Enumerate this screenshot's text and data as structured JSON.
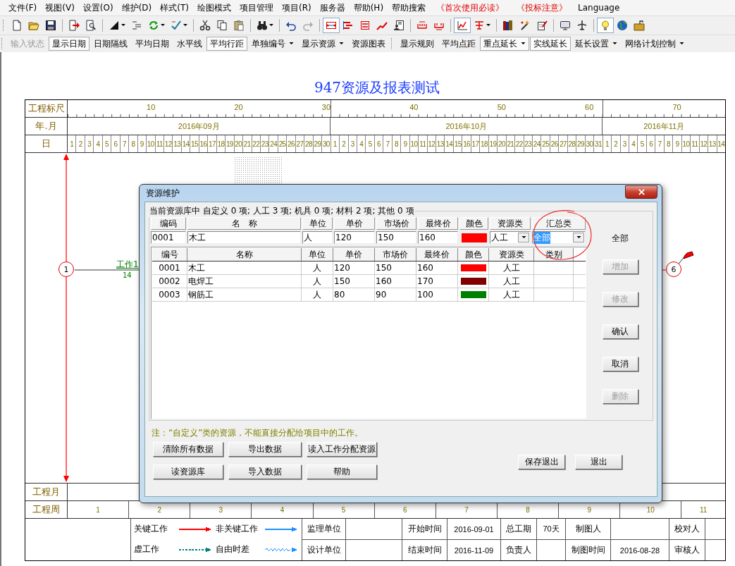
{
  "menu": [
    {
      "label": "文件(F)",
      "kind": "normal"
    },
    {
      "label": "视图(V)",
      "kind": "normal"
    },
    {
      "label": "设置(O)",
      "kind": "normal"
    },
    {
      "label": "维护(D)",
      "kind": "normal"
    },
    {
      "label": "样式(T)",
      "kind": "normal"
    },
    {
      "label": "绘图模式",
      "kind": "normal"
    },
    {
      "label": "项目管理",
      "kind": "normal"
    },
    {
      "label": "项目(R)",
      "kind": "normal"
    },
    {
      "label": "服务器",
      "kind": "normal"
    },
    {
      "label": "帮助(H)",
      "kind": "normal"
    },
    {
      "label": "帮助搜索",
      "kind": "normal"
    },
    {
      "label": "《首次使用必读》",
      "kind": "notice"
    },
    {
      "label": "《投标注意》",
      "kind": "notice"
    },
    {
      "label": "Language",
      "kind": "normal"
    }
  ],
  "toolbar_buttons": [
    {
      "pressed": false,
      "dropdown": false
    },
    {
      "pressed": false,
      "dropdown": false
    },
    {
      "pressed": false,
      "dropdown": false
    },
    {
      "pressed": false,
      "dropdown": false
    },
    {
      "pressed": false,
      "dropdown": false
    },
    {
      "pressed": false,
      "dropdown": true
    },
    {
      "pressed": false,
      "dropdown": false
    },
    {
      "pressed": false,
      "dropdown": true
    },
    {
      "pressed": false,
      "dropdown": true
    },
    {
      "pressed": false,
      "dropdown": false
    },
    {
      "pressed": false,
      "dropdown": false
    },
    {
      "pressed": false,
      "dropdown": false
    },
    {
      "pressed": false,
      "dropdown": true
    },
    {
      "pressed": false,
      "dropdown": false
    },
    {
      "pressed": false,
      "dropdown": false
    },
    {
      "pressed": true,
      "dropdown": false
    },
    {
      "pressed": false,
      "dropdown": false
    },
    {
      "pressed": false,
      "dropdown": false
    },
    {
      "pressed": false,
      "dropdown": false
    },
    {
      "pressed": false,
      "dropdown": false
    },
    {
      "pressed": false,
      "dropdown": false
    },
    {
      "pressed": false,
      "dropdown": false
    },
    {
      "pressed": true,
      "dropdown": false
    },
    {
      "pressed": false,
      "dropdown": true
    },
    {
      "pressed": false,
      "dropdown": false
    },
    {
      "pressed": false,
      "dropdown": false
    },
    {
      "pressed": false,
      "dropdown": false
    },
    {
      "pressed": false,
      "dropdown": false
    },
    {
      "pressed": false,
      "dropdown": false
    },
    {
      "pressed": true,
      "dropdown": false
    },
    {
      "pressed": false,
      "dropdown": false
    },
    {
      "pressed": false,
      "dropdown": false
    }
  ],
  "toolbar2": [
    [
      {
        "label": "输入状态",
        "disabled": true,
        "pressed": false,
        "dropdown": false
      },
      {
        "label": "显示日期",
        "disabled": false,
        "pressed": true,
        "dropdown": false
      },
      {
        "label": "日期隔线",
        "disabled": false,
        "pressed": false,
        "dropdown": false
      },
      {
        "label": "平均日期",
        "disabled": false,
        "pressed": false,
        "dropdown": false
      },
      {
        "label": "水平线",
        "disabled": false,
        "pressed": false,
        "dropdown": false
      },
      {
        "label": "平均行距",
        "disabled": false,
        "pressed": true,
        "dropdown": false
      },
      {
        "label": "单独编号",
        "disabled": false,
        "pressed": false,
        "dropdown": true
      },
      {
        "label": "显示资源",
        "disabled": false,
        "pressed": false,
        "dropdown": true
      },
      {
        "label": "资源图表",
        "disabled": false,
        "pressed": false,
        "dropdown": false
      }
    ],
    [
      {
        "label": "显示规则",
        "disabled": false,
        "pressed": false,
        "dropdown": false
      },
      {
        "label": "平均点距",
        "disabled": false,
        "pressed": false,
        "dropdown": false
      },
      {
        "label": "重点延长",
        "disabled": false,
        "pressed": true,
        "dropdown": true
      },
      {
        "label": "实线延长",
        "disabled": false,
        "pressed": true,
        "dropdown": false
      },
      {
        "label": "延长设置",
        "disabled": false,
        "pressed": false,
        "dropdown": true
      },
      {
        "label": "网络计划控制",
        "disabled": false,
        "pressed": false,
        "dropdown": true
      }
    ]
  ],
  "chart_title": "947资源及报表测试",
  "ruler": {
    "label": "工程标尺",
    "ticks": [
      "10",
      "20",
      "30",
      "40",
      "50",
      "60",
      "70"
    ]
  },
  "month_row": {
    "label": "年.月",
    "months": [
      {
        "label": "2016年09月",
        "days": [
          "1",
          "2",
          "3",
          "4",
          "5",
          "6",
          "7",
          "8",
          "9",
          "10",
          "11",
          "12",
          "13",
          "14",
          "15",
          "16",
          "17",
          "18",
          "19",
          "20",
          "21",
          "22",
          "23",
          "24",
          "25",
          "26",
          "27",
          "28",
          "29",
          "30"
        ]
      },
      {
        "label": "2016年10月",
        "days": [
          "1",
          "2",
          "3",
          "4",
          "5",
          "6",
          "7",
          "8",
          "9",
          "10",
          "11",
          "12",
          "13",
          "14",
          "15",
          "16",
          "17",
          "18",
          "19",
          "20",
          "21",
          "22",
          "23",
          "24",
          "25",
          "26",
          "27",
          "28",
          "29",
          "30",
          "31"
        ]
      },
      {
        "label": "2016年11月",
        "days": [
          "1",
          "2",
          "3",
          "4",
          "5",
          "6",
          "7",
          "8",
          "9",
          "10",
          "11",
          "12",
          "13",
          "14"
        ]
      }
    ]
  },
  "day_label": "日",
  "diagram": {
    "nodes": [
      {
        "label": "1"
      },
      {
        "label": "6"
      }
    ],
    "work": {
      "name": "工作1",
      "duration": "14"
    }
  },
  "project_month_label": "工程月",
  "project_week": {
    "label": "工程周",
    "weeks": [
      "1",
      "2",
      "3",
      "4",
      "5",
      "6",
      "7",
      "8",
      "9",
      "10",
      "11"
    ]
  },
  "legend": [
    {
      "label": "关键工作",
      "kind": "solid",
      "color": "#ff0000"
    },
    {
      "label": "非关键工作",
      "kind": "solid",
      "color": "#1e90ff"
    },
    {
      "label": "虚工作",
      "kind": "dashed",
      "color": "#008080"
    },
    {
      "label": "自由时差",
      "kind": "wavy",
      "color": "#1e90ff"
    }
  ],
  "info_rows": [
    [
      {
        "label": "监理单位"
      },
      {
        "label": "开始时间",
        "value": "2016-09-01"
      },
      {
        "label": "总工期",
        "value": "70天"
      },
      {
        "label": "制图人"
      },
      {
        "label": "校对人"
      }
    ],
    [
      {
        "label": "设计单位"
      },
      {
        "label": "结束时间",
        "value": "2016-11-09"
      },
      {
        "label": "负责人"
      },
      {
        "label": "制图时间",
        "value": "2016-08-28"
      },
      {
        "label": "审核人"
      }
    ]
  ],
  "dialog": {
    "title": "资源维护",
    "group_caption": "当前资源库中 自定义 0 项; 人工 3 项; 机具 0 项; 材料 2 项; 其他 0 项",
    "edit_headers": [
      "编码",
      "名　称",
      "单位",
      "单价",
      "市场价",
      "最终价",
      "颜色",
      "资源类",
      "汇总类"
    ],
    "edit": {
      "code": "0001",
      "name": "木工",
      "unit": "人",
      "price": "120",
      "market_price": "150",
      "final_price": "160",
      "color": "#ff0000",
      "resource_type": "人工",
      "summary_type": "全部"
    },
    "side_label": "全部",
    "columns": [
      "编号",
      "名称",
      "单位",
      "单价",
      "市场价",
      "最终价",
      "颜色",
      "资源类",
      "类别"
    ],
    "rows": [
      {
        "code": "0001",
        "name": "木工",
        "unit": "人",
        "price": "120",
        "market_price": "150",
        "final_price": "160",
        "color": "#ff0000",
        "type": "人工",
        "selected": false
      },
      {
        "code": "0002",
        "name": "电焊工",
        "unit": "人",
        "price": "150",
        "market_price": "160",
        "final_price": "170",
        "color": "#800000",
        "type": "人工",
        "selected": false
      },
      {
        "code": "0003",
        "name": "钢筋工",
        "unit": "人",
        "price": "80",
        "market_price": "90",
        "final_price": "100",
        "color": "#008000",
        "type": "人工",
        "selected": false
      }
    ],
    "side_buttons": [
      {
        "label": "增加",
        "disabled": true
      },
      {
        "label": "修改",
        "disabled": true
      },
      {
        "label": "确认",
        "disabled": false
      },
      {
        "label": "取消",
        "disabled": false
      },
      {
        "label": "删除",
        "disabled": true
      }
    ],
    "note": "注：“自定义”类的资源，不能直接分配给项目中的工作。",
    "left_buttons": [
      "清除所有数据",
      "导出数据",
      "读入工作分配资源",
      "读资源库",
      "导入数据",
      "帮助"
    ],
    "right_buttons": [
      "保存退出",
      "退出"
    ]
  }
}
